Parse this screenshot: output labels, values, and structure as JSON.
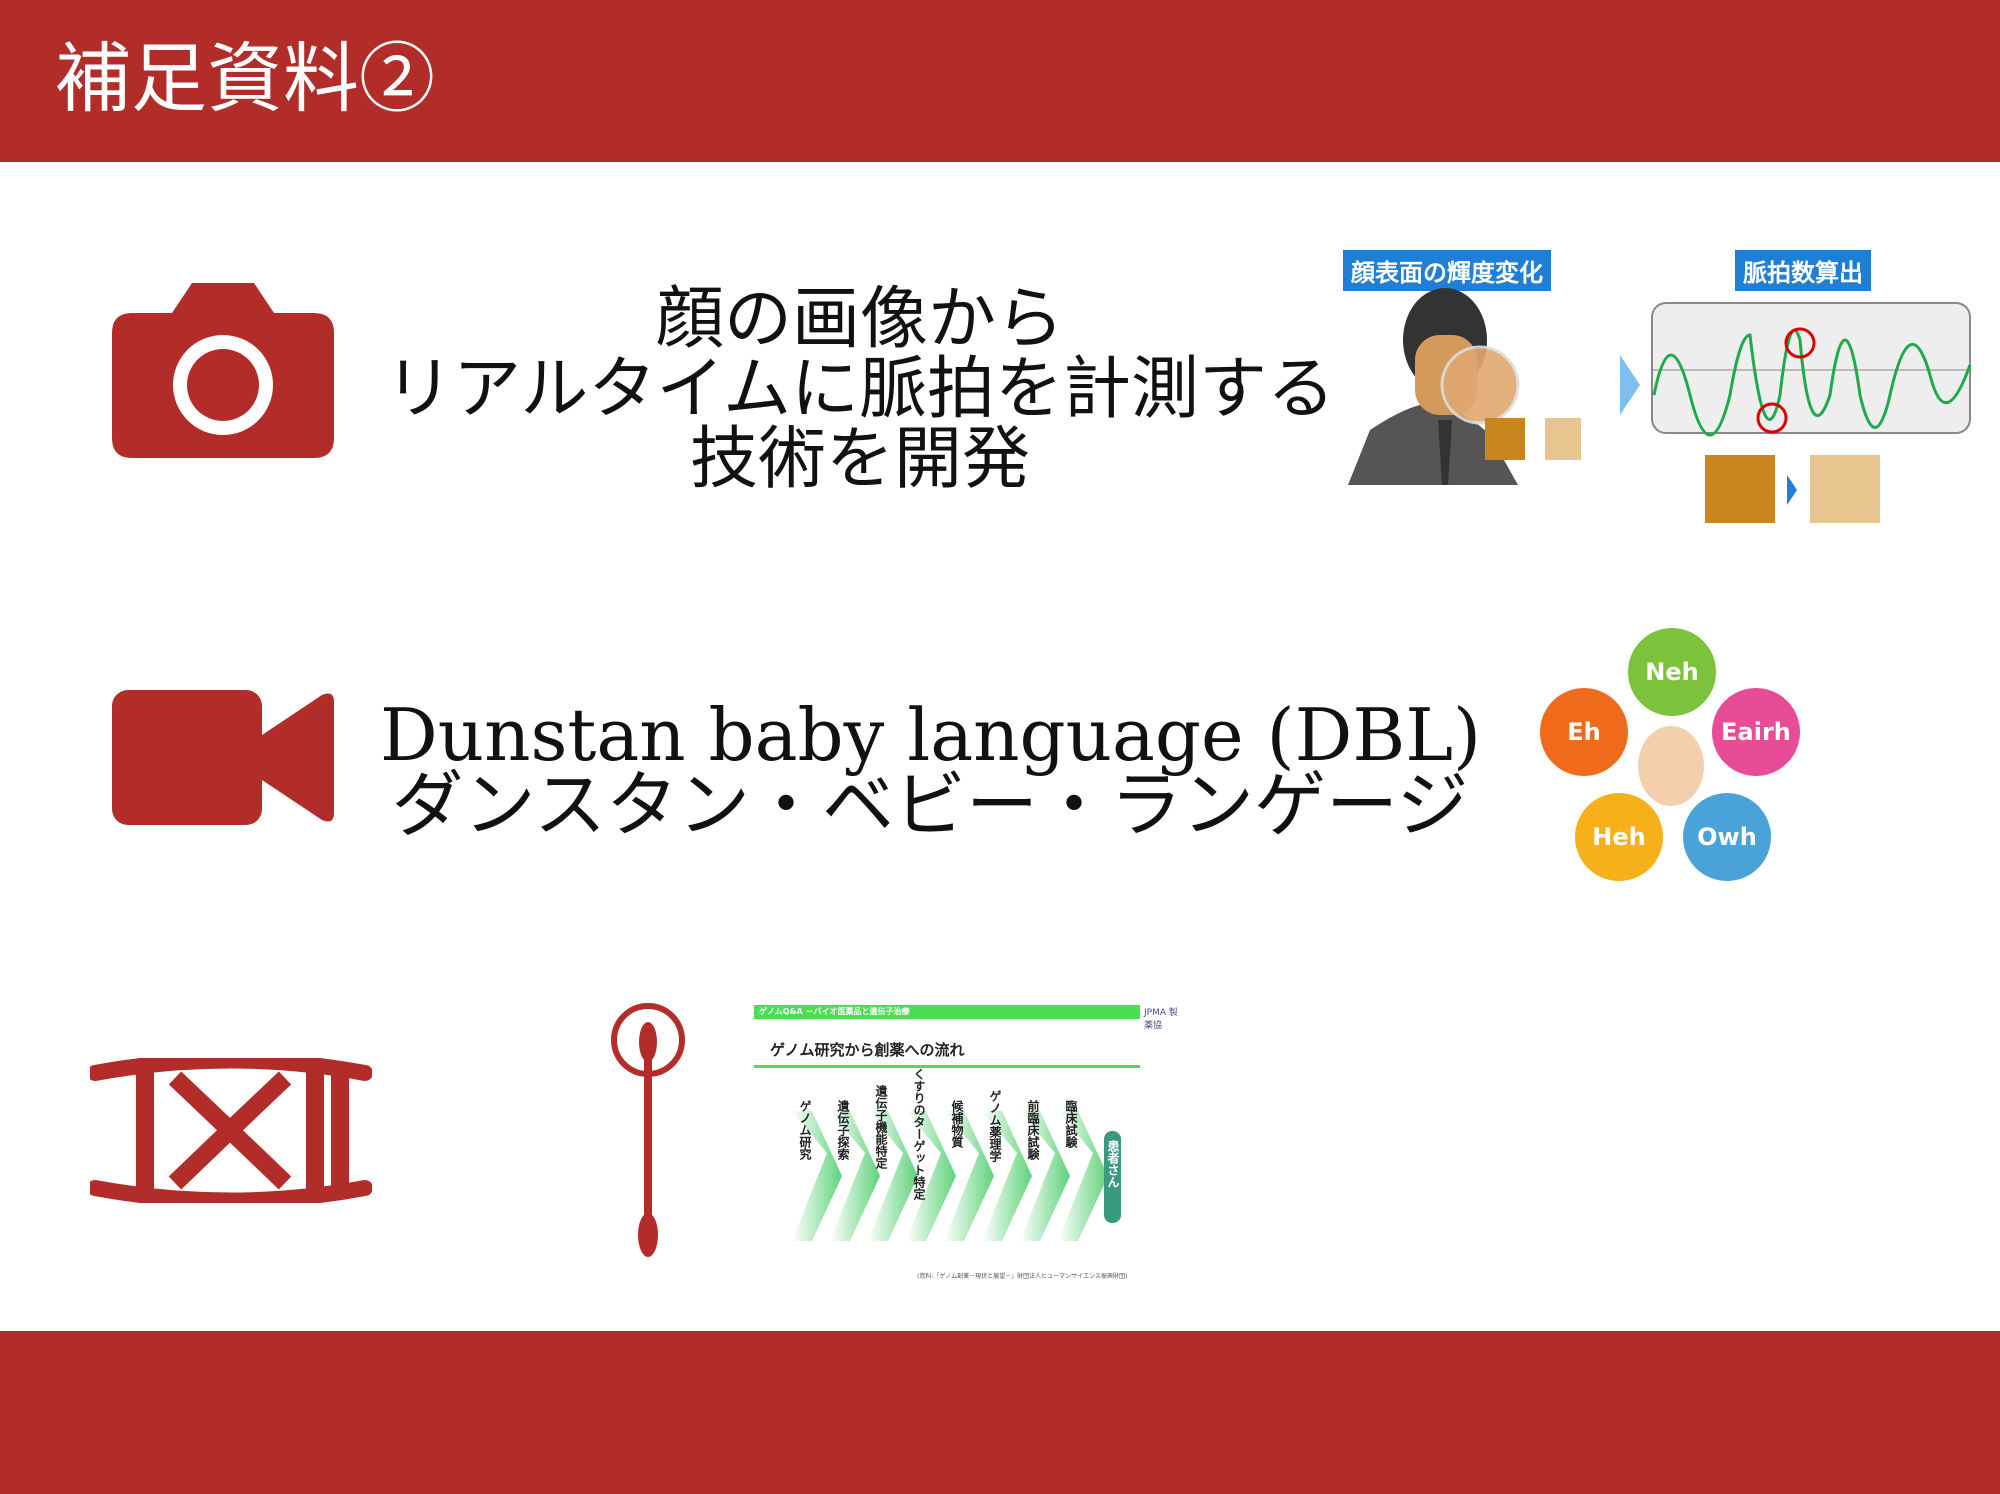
{
  "header": {
    "title": "補足資料②"
  },
  "section1": {
    "lines": [
      "顔の画像から",
      "リアルタイムに脈拍を計測する",
      "技術を開発"
    ],
    "figure": {
      "label_left": "顔表面の輝度変化",
      "label_right": "脈拍数算出"
    }
  },
  "section2": {
    "lines": [
      "Dunstan baby language (DBL)",
      "ダンスタン・ベビー・ランゲージ"
    ],
    "bubbles": [
      "Neh",
      "Eh",
      "Eairh",
      "Heh",
      "Owh"
    ]
  },
  "section3": {
    "figure": {
      "header": "ゲノムQ&A －バイオ医薬品と遺伝子治療",
      "title": "ゲノム研究から創薬への流れ",
      "steps": [
        "ゲノム研究",
        "遺伝子探索",
        "遺伝子機能特定",
        "くすりのターゲット特定",
        "候補物質",
        "ゲノム薬理学",
        "前臨床試験",
        "臨床試験"
      ],
      "end": "患者さん",
      "source": "(資料:「ゲノム創薬－現状と展望－」財団法人ヒューマンサイエンス振興財団)",
      "logo": "JPMA 製薬協"
    }
  },
  "colors": {
    "brand": "#b22d29",
    "accent": "#1f7ed6",
    "green": "#4cdd55"
  }
}
